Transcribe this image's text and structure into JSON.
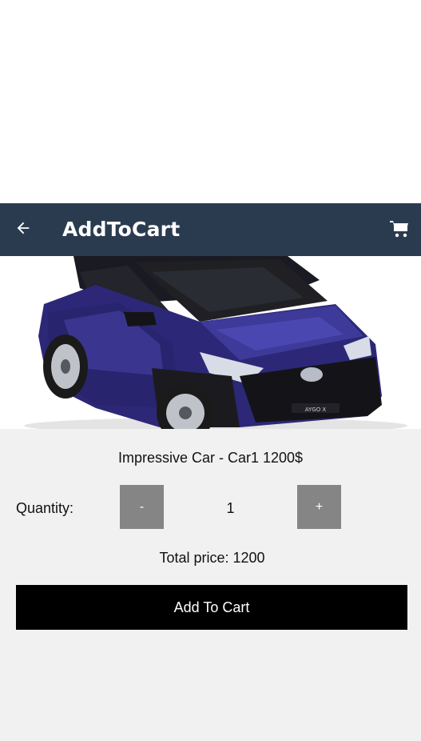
{
  "appbar": {
    "title": "AddToCart",
    "back_icon": "arrow-left-icon",
    "cart_icon": "shopping-cart-icon",
    "background": "#2b3b4f"
  },
  "product": {
    "image_label": "AYGO X",
    "title": "Impressive Car - Car1 1200$"
  },
  "quantity": {
    "label": "Quantity:",
    "minus_label": "-",
    "value": "1",
    "plus_label": "+"
  },
  "total": {
    "text": "Total price: 1200"
  },
  "actions": {
    "add_to_cart_label": "Add To Cart"
  }
}
